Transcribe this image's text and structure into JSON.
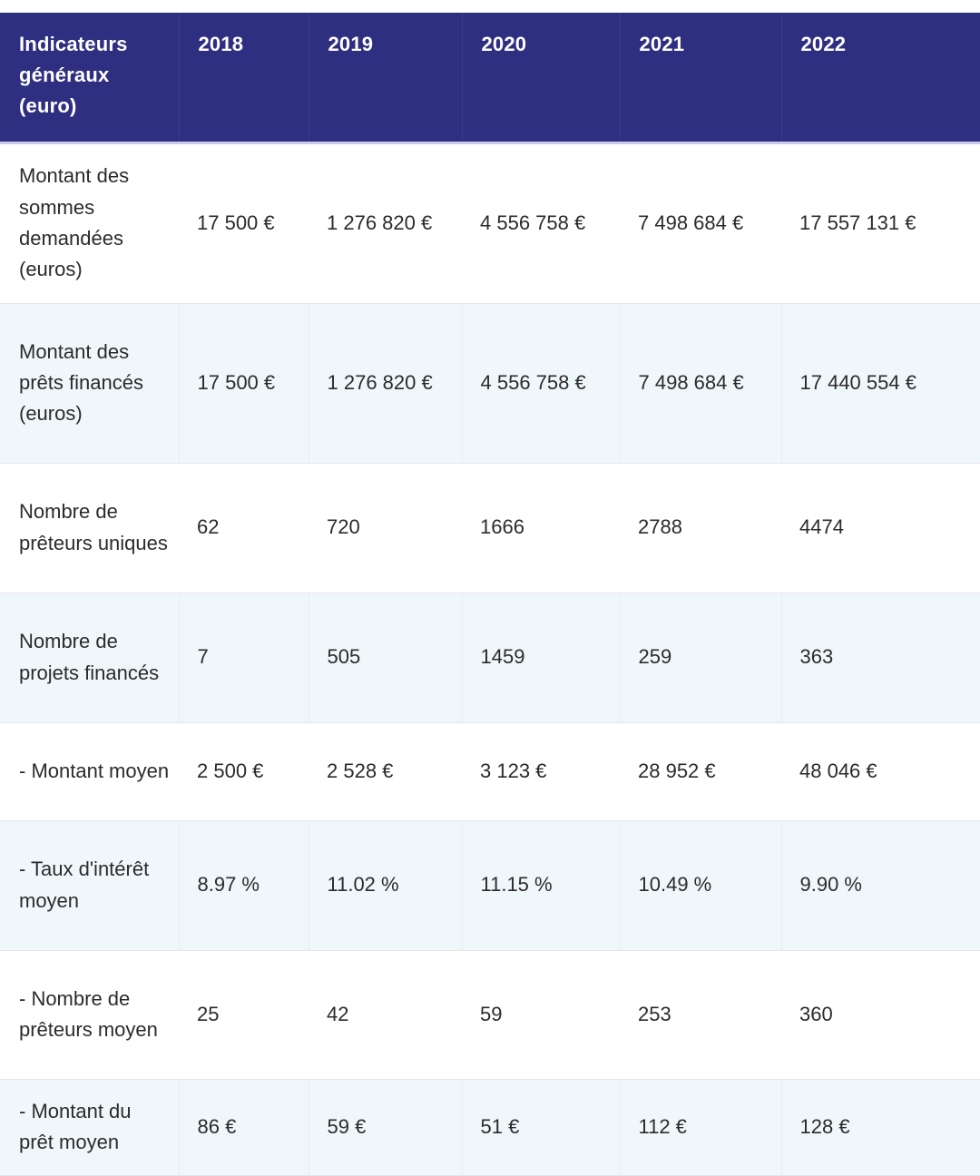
{
  "table": {
    "headers": [
      "Indicateurs généraux (euro)",
      "2018",
      "2019",
      "2020",
      "2021",
      "2022"
    ],
    "rows": [
      [
        "Montant des sommes demandées (euros)",
        "17 500 €",
        "1 276 820 €",
        "4 556 758 €",
        "7 498 684 €",
        "17 557 131 €"
      ],
      [
        "Montant des prêts financés (euros)",
        "17 500 €",
        "1 276 820 €",
        "4 556 758 €",
        "7 498 684 €",
        "17 440 554 €"
      ],
      [
        "Nombre de prêteurs uniques",
        "62",
        "720",
        "1666",
        "2788",
        "4474"
      ],
      [
        "Nombre de projets financés",
        "7",
        "505",
        "1459",
        "259",
        "363"
      ],
      [
        "- Montant moyen",
        "2 500 €",
        "2 528 €",
        "3 123 €",
        "28 952 €",
        "48 046 €"
      ],
      [
        "- Taux d'intérêt moyen",
        "8.97 %",
        "11.02 %",
        "11.15 %",
        "10.49 %",
        "9.90 %"
      ],
      [
        "- Nombre de prêteurs moyen",
        "25",
        "42",
        "59",
        "253",
        "360"
      ],
      [
        "- Montant du prêt moyen",
        "86 €",
        "59 €",
        "51 €",
        "112 €",
        "128 €"
      ]
    ]
  },
  "colors": {
    "header_background": "#2e2f80",
    "header_text": "#ffffff",
    "row_alt_background": "#f0f7fb",
    "text": "#2b2b2b"
  }
}
